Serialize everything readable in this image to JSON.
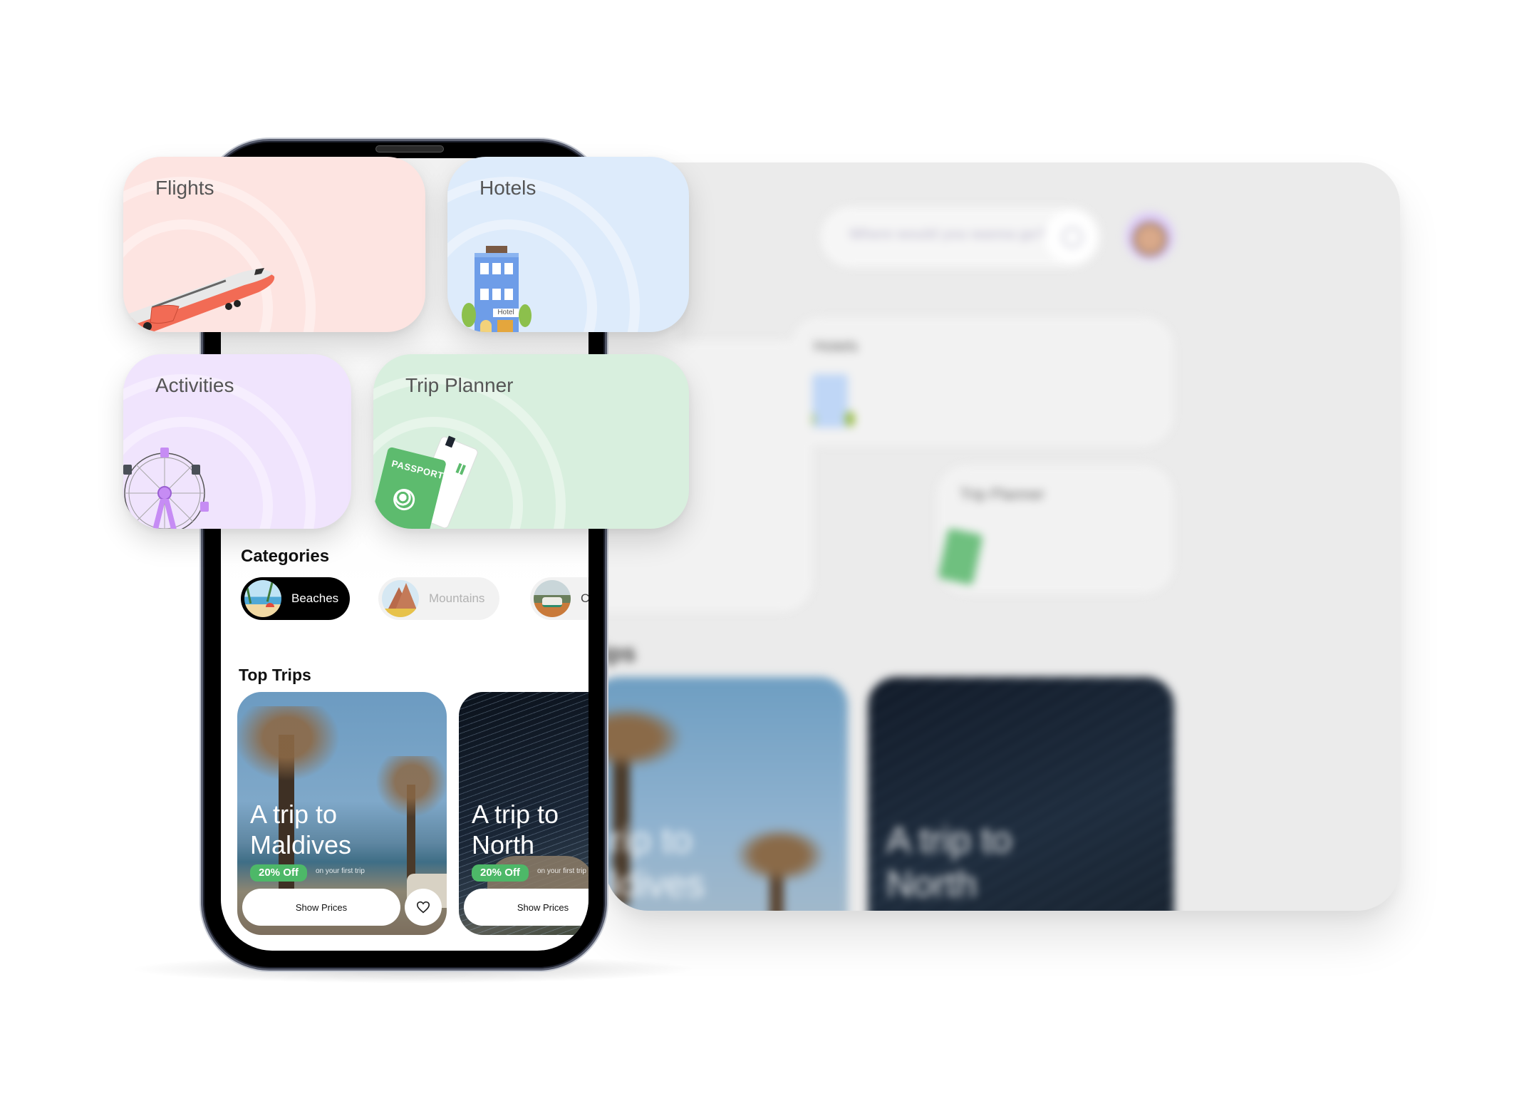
{
  "background_dashboard": {
    "search": {
      "placeholder": "Where would you wanna go?"
    },
    "cards": [
      {
        "title": "Hotels",
        "icon": "hotel-illustration"
      },
      {
        "title": "Trip Planner",
        "icon": "passport-illustration"
      }
    ],
    "section_title": "Top Trips",
    "section_title_visible": "rips",
    "trips": [
      {
        "title_line1": "A trip to",
        "title_line2": "Maldives",
        "visible_line1": "rip to",
        "visible_line2": "ldives"
      },
      {
        "title_line1": "A trip to",
        "title_line2": "North"
      }
    ]
  },
  "tiles": [
    {
      "title": "Flights",
      "icon": "airplane-illustration",
      "color": "#FDE4E1"
    },
    {
      "title": "Hotels",
      "icon": "hotel-illustration",
      "color": "#DDEBFB",
      "sign": "Hotel"
    },
    {
      "title": "Activities",
      "icon": "ferris-wheel-illustration",
      "color": "#F0E4FD"
    },
    {
      "title": "Trip Planner",
      "icon": "passport-illustration",
      "color": "#D8EFDE",
      "passport_label": "PASSPORT"
    }
  ],
  "phone": {
    "categories_heading": "Categories",
    "categories": [
      {
        "label": "Beaches",
        "active": true
      },
      {
        "label": "Mountains",
        "active": false
      },
      {
        "label": "Ca",
        "active": false
      }
    ],
    "top_trips_heading": "Top Trips",
    "trips": [
      {
        "title_line1": "A trip to",
        "title_line2": "Maldives",
        "discount": "20% Off",
        "note": "on your first trip",
        "button": "Show Prices"
      },
      {
        "title_line1": "A trip to",
        "title_line2": "North",
        "discount": "20% Off",
        "note": "on your first trip",
        "button": "Show Prices"
      }
    ]
  },
  "colors": {
    "accent_green": "#4DB868",
    "active_chip": "#000000",
    "background_panel": "#EBEBEB"
  }
}
